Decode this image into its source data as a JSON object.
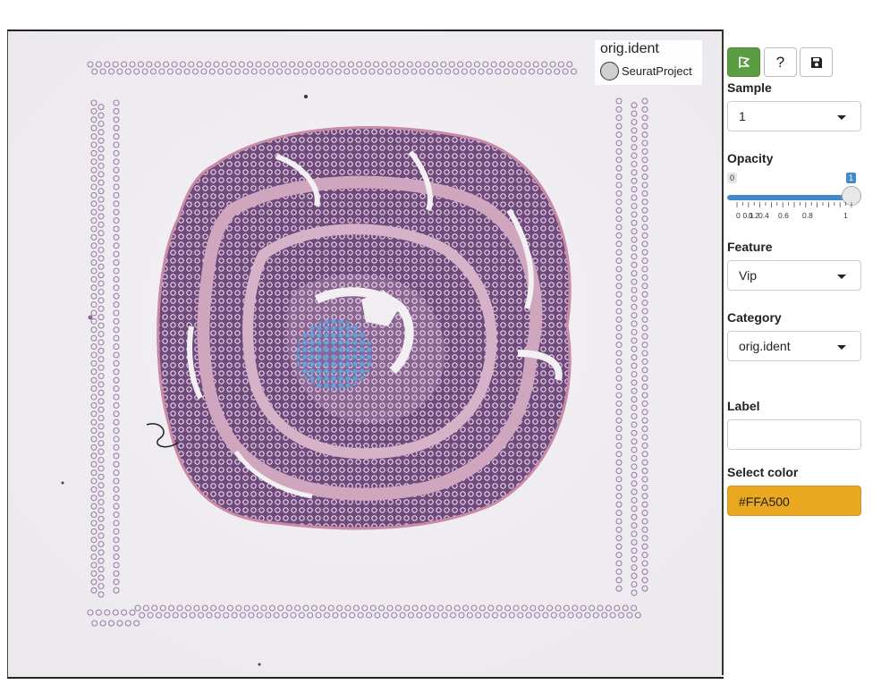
{
  "legend": {
    "title": "orig.ident",
    "label": "SeuratProject"
  },
  "toolbar": {
    "lasso_icon": "lasso-select-icon",
    "help_label": "?",
    "save_icon": "save-icon"
  },
  "sample": {
    "label": "Sample",
    "value": "1"
  },
  "opacity": {
    "label": "Opacity",
    "min": "0",
    "max": "1",
    "value": 1,
    "ticks": [
      "0",
      "0.1",
      "0.2",
      "0.4",
      "0.6",
      "0.8",
      "1"
    ]
  },
  "feature": {
    "label": "Feature",
    "value": "Vip"
  },
  "category": {
    "label": "Category",
    "value": "orig.ident"
  },
  "label_field": {
    "label": "Label",
    "value": ""
  },
  "select_color": {
    "label": "Select color",
    "value": "#FFA500"
  },
  "colors": {
    "accent": "#5c9c43",
    "slider": "#428bca",
    "color_swatch": "#e9a81f",
    "highlight_spots": "#5b8fd1"
  }
}
